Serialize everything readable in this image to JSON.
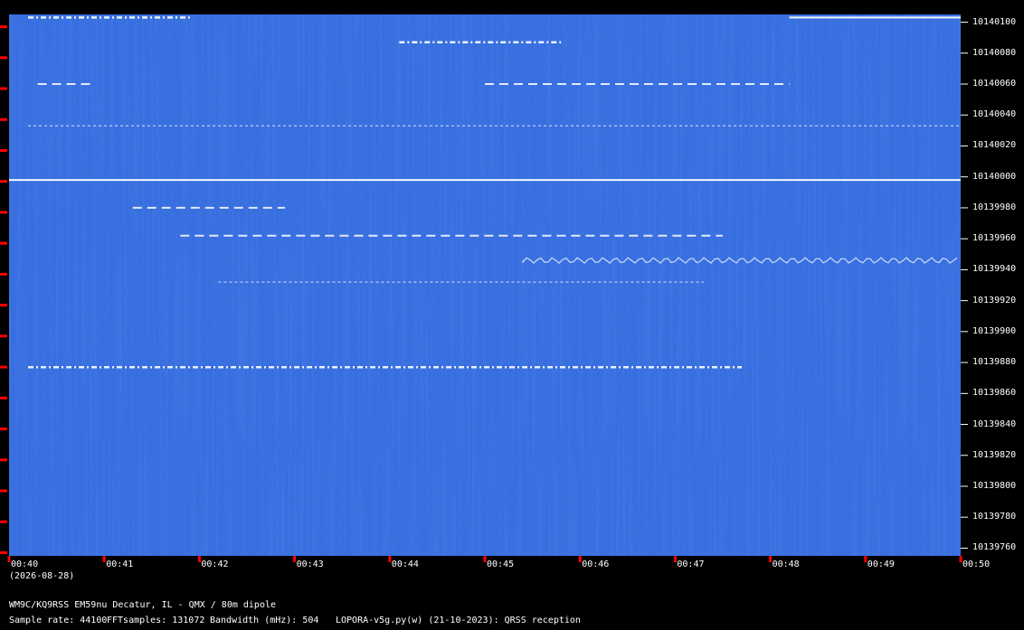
{
  "chart_data": {
    "type": "heatmap",
    "title": "",
    "x_ticks": [
      "00:40",
      "00:41",
      "00:42",
      "00:43",
      "00:44",
      "00:45",
      "00:46",
      "00:47",
      "00:48",
      "00:49",
      "00:50"
    ],
    "xlim": [
      "00:40",
      "00:50"
    ],
    "date": "(2026-08-28)",
    "y_ticks": [
      10140100,
      10140080,
      10140060,
      10140040,
      10140020,
      10140000,
      10139980,
      10139960,
      10139940,
      10139920,
      10139900,
      10139880,
      10139860,
      10139840,
      10139820,
      10139800,
      10139780,
      10139760
    ],
    "ylim": [
      10139755,
      10140105
    ],
    "colors": {
      "background": "#000000",
      "noise_base": "#0a2a5a",
      "signal": "#ffffff",
      "tick_marker": "#ff0000"
    },
    "signals": [
      {
        "y": 10140103,
        "x": [
          "00:40.2",
          "00:41.9"
        ],
        "style": "dashed"
      },
      {
        "y": 10140103,
        "x": [
          "00:48.2",
          "00:50"
        ],
        "style": "solid"
      },
      {
        "y": 10140087,
        "x": [
          "00:44.1",
          "00:45.8"
        ],
        "style": "dashed"
      },
      {
        "y": 10140060,
        "x": [
          "00:40.3",
          "00:40.9"
        ],
        "style": "dotted"
      },
      {
        "y": 10140060,
        "x": [
          "00:45.0",
          "00:48.2"
        ],
        "style": "dotted"
      },
      {
        "y": 10140033,
        "x": [
          "00:40.2",
          "00:50"
        ],
        "style": "faint"
      },
      {
        "y": 10139998,
        "x": [
          "00:40",
          "00:50"
        ],
        "style": "solid"
      },
      {
        "y": 10139980,
        "x": [
          "00:41.3",
          "00:42.9"
        ],
        "style": "dotted"
      },
      {
        "y": 10139962,
        "x": [
          "00:41.8",
          "00:47.5"
        ],
        "style": "dotted"
      },
      {
        "y": 10139946,
        "x": [
          "00:45.4",
          "00:50"
        ],
        "style": "wavy"
      },
      {
        "y": 10139932,
        "x": [
          "00:42.2",
          "00:47.3"
        ],
        "style": "faint"
      },
      {
        "y": 10139877,
        "x": [
          "00:40.2",
          "00:47.7"
        ],
        "style": "dashed"
      }
    ]
  },
  "footer": {
    "station": "WM9C/KQ9RSS EM59nu Decatur, IL - QMX / 80m dipole",
    "sample_rate": "Sample rate: 44100",
    "fft_samples": "FFTsamples: 131072",
    "bandwidth": "Bandwidth (mHz): 504",
    "software": "LOPORA-v5g.py(w) (21-10-2023): QRSS reception"
  }
}
